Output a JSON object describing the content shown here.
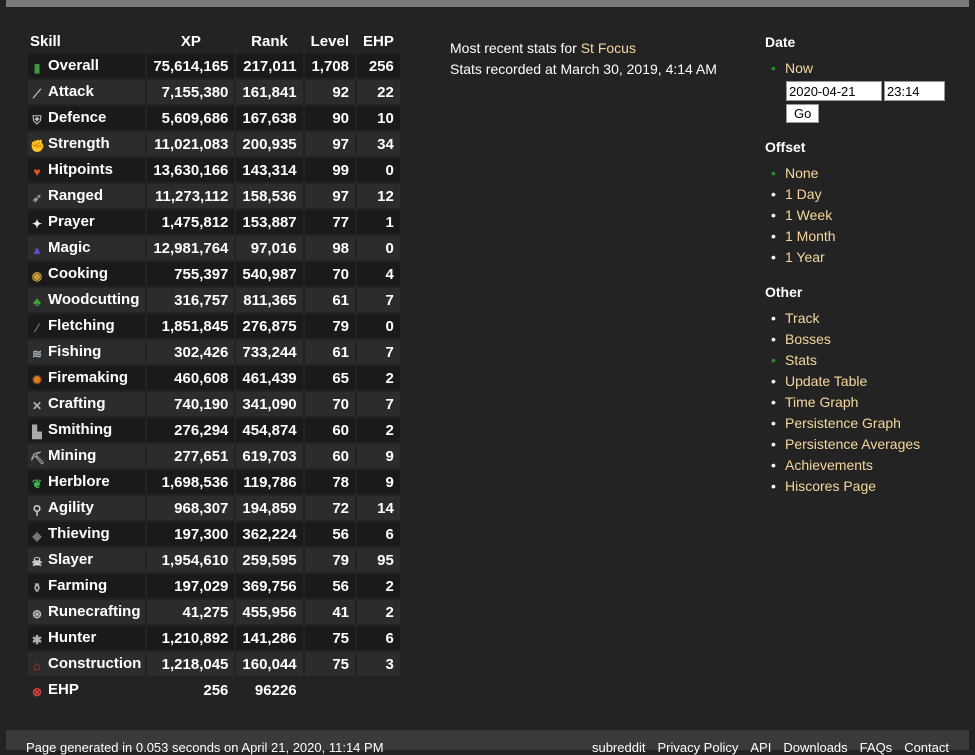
{
  "table": {
    "headers": {
      "skill": "Skill",
      "xp": "XP",
      "rank": "Rank",
      "level": "Level",
      "ehp": "EHP"
    },
    "rows": [
      {
        "icon": "overall-icon",
        "skill": "Overall",
        "xp": "75,614,165",
        "rank": "217,011",
        "level": "1,708",
        "ehp": "256"
      },
      {
        "icon": "attack-icon",
        "skill": "Attack",
        "xp": "7,155,380",
        "rank": "161,841",
        "level": "92",
        "ehp": "22"
      },
      {
        "icon": "defence-icon",
        "skill": "Defence",
        "xp": "5,609,686",
        "rank": "167,638",
        "level": "90",
        "ehp": "10"
      },
      {
        "icon": "strength-icon",
        "skill": "Strength",
        "xp": "11,021,083",
        "rank": "200,935",
        "level": "97",
        "ehp": "34"
      },
      {
        "icon": "hitpoints-icon",
        "skill": "Hitpoints",
        "xp": "13,630,166",
        "rank": "143,314",
        "level": "99",
        "ehp": "0"
      },
      {
        "icon": "ranged-icon",
        "skill": "Ranged",
        "xp": "11,273,112",
        "rank": "158,536",
        "level": "97",
        "ehp": "12"
      },
      {
        "icon": "prayer-icon",
        "skill": "Prayer",
        "xp": "1,475,812",
        "rank": "153,887",
        "level": "77",
        "ehp": "1"
      },
      {
        "icon": "magic-icon",
        "skill": "Magic",
        "xp": "12,981,764",
        "rank": "97,016",
        "level": "98",
        "ehp": "0"
      },
      {
        "icon": "cooking-icon",
        "skill": "Cooking",
        "xp": "755,397",
        "rank": "540,987",
        "level": "70",
        "ehp": "4"
      },
      {
        "icon": "woodcutting-icon",
        "skill": "Woodcutting",
        "xp": "316,757",
        "rank": "811,365",
        "level": "61",
        "ehp": "7"
      },
      {
        "icon": "fletching-icon",
        "skill": "Fletching",
        "xp": "1,851,845",
        "rank": "276,875",
        "level": "79",
        "ehp": "0"
      },
      {
        "icon": "fishing-icon",
        "skill": "Fishing",
        "xp": "302,426",
        "rank": "733,244",
        "level": "61",
        "ehp": "7"
      },
      {
        "icon": "firemaking-icon",
        "skill": "Firemaking",
        "xp": "460,608",
        "rank": "461,439",
        "level": "65",
        "ehp": "2"
      },
      {
        "icon": "crafting-icon",
        "skill": "Crafting",
        "xp": "740,190",
        "rank": "341,090",
        "level": "70",
        "ehp": "7"
      },
      {
        "icon": "smithing-icon",
        "skill": "Smithing",
        "xp": "276,294",
        "rank": "454,874",
        "level": "60",
        "ehp": "2"
      },
      {
        "icon": "mining-icon",
        "skill": "Mining",
        "xp": "277,651",
        "rank": "619,703",
        "level": "60",
        "ehp": "9"
      },
      {
        "icon": "herblore-icon",
        "skill": "Herblore",
        "xp": "1,698,536",
        "rank": "119,786",
        "level": "78",
        "ehp": "9"
      },
      {
        "icon": "agility-icon",
        "skill": "Agility",
        "xp": "968,307",
        "rank": "194,859",
        "level": "72",
        "ehp": "14"
      },
      {
        "icon": "thieving-icon",
        "skill": "Thieving",
        "xp": "197,300",
        "rank": "362,224",
        "level": "56",
        "ehp": "6"
      },
      {
        "icon": "slayer-icon",
        "skill": "Slayer",
        "xp": "1,954,610",
        "rank": "259,595",
        "level": "79",
        "ehp": "95"
      },
      {
        "icon": "farming-icon",
        "skill": "Farming",
        "xp": "197,029",
        "rank": "369,756",
        "level": "56",
        "ehp": "2"
      },
      {
        "icon": "runecrafting-icon",
        "skill": "Runecrafting",
        "xp": "41,275",
        "rank": "455,956",
        "level": "41",
        "ehp": "2"
      },
      {
        "icon": "hunter-icon",
        "skill": "Hunter",
        "xp": "1,210,892",
        "rank": "141,286",
        "level": "75",
        "ehp": "6"
      },
      {
        "icon": "construction-icon",
        "skill": "Construction",
        "xp": "1,218,045",
        "rank": "160,044",
        "level": "75",
        "ehp": "3"
      }
    ],
    "ehp_row": {
      "icon": "ehp-icon",
      "skill": "EHP",
      "xp": "256",
      "rank": "96226"
    }
  },
  "recent": {
    "prefix": "Most recent stats for ",
    "player": "St Focus",
    "recorded": "Stats recorded at March 30, 2019, 4:14 AM"
  },
  "sidebar": {
    "date_title": "Date",
    "date_items": [
      "Now"
    ],
    "date_value": "2020-04-21",
    "time_value": "23:14",
    "go_label": "Go",
    "offset_title": "Offset",
    "offset_items": [
      "None",
      "1 Day",
      "1 Week",
      "1 Month",
      "1 Year"
    ],
    "other_title": "Other",
    "other_items": [
      "Track",
      "Bosses",
      "Stats",
      "Update Table",
      "Time Graph",
      "Persistence Graph",
      "Persistence Averages",
      "Achievements",
      "Hiscores Page"
    ]
  },
  "footer": {
    "generated": "Page generated in 0.053 seconds on April 21, 2020, 11:14 PM",
    "links": [
      "subreddit",
      "Privacy Policy",
      "API",
      "Downloads",
      "FAQs",
      "Contact"
    ]
  },
  "colors": {
    "link": "#f5d79e",
    "active_bullet": "#2d8a2d",
    "background": "#232323"
  }
}
